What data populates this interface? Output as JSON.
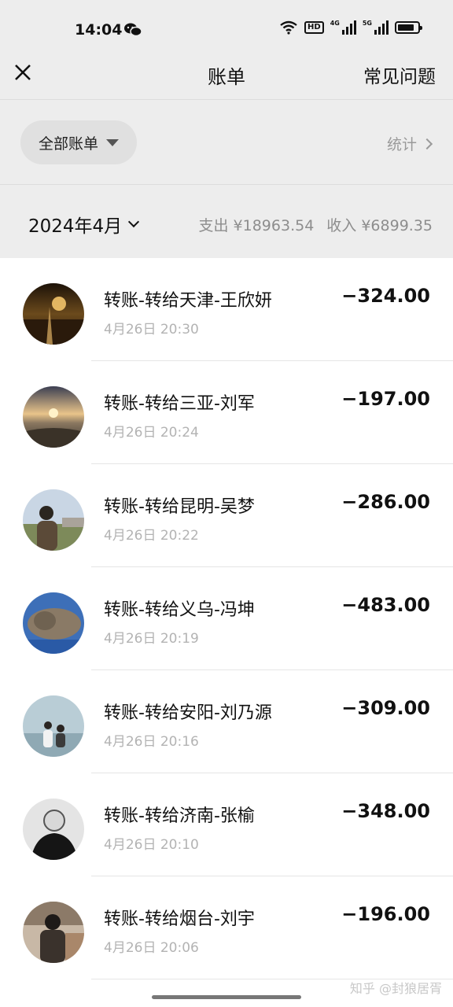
{
  "status_bar": {
    "time": "14:04",
    "network_labels": [
      "HD",
      "4G",
      "5G"
    ]
  },
  "nav": {
    "title": "账单",
    "faq_label": "常见问题"
  },
  "filter": {
    "all_bills_label": "全部账单",
    "stats_label": "统计"
  },
  "month": {
    "label": "2024年4月",
    "expense_label": "支出 ¥18963.54",
    "income_label": "收入 ¥6899.35"
  },
  "transactions": [
    {
      "title": "转账-转给天津-王欣妍",
      "time": "4月26日 20:30",
      "amount": "−324.00"
    },
    {
      "title": "转账-转给三亚-刘军",
      "time": "4月26日 20:24",
      "amount": "−197.00"
    },
    {
      "title": "转账-转给昆明-吴梦",
      "time": "4月26日 20:22",
      "amount": "−286.00"
    },
    {
      "title": "转账-转给义乌-冯坤",
      "time": "4月26日 20:19",
      "amount": "−483.00"
    },
    {
      "title": "转账-转给安阳-刘乃源",
      "time": "4月26日 20:16",
      "amount": "−309.00"
    },
    {
      "title": "转账-转给济南-张榆",
      "time": "4月26日 20:10",
      "amount": "−348.00"
    },
    {
      "title": "转账-转给烟台-刘宇",
      "time": "4月26日 20:06",
      "amount": "−196.00"
    }
  ],
  "watermark": "知乎 @封狼居胥"
}
